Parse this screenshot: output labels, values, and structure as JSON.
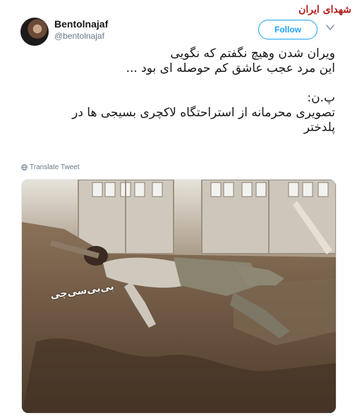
{
  "header": {
    "display_name": "Bentolnajaf",
    "handle": "@bentolnajaf",
    "follow_label": "Follow",
    "watermark": "شهدای ایران"
  },
  "tweet": {
    "lines": [
      "ویران شدن وهیچ نگفتم که نگویی",
      "این مرد عجب عاشق کم حوصله ای بود ...",
      "پ.ن:",
      "تصویری محرمانه از استراحتگاه لاکچری بسیجی ها در",
      "پلدختر"
    ],
    "translate_label": "Translate Tweet"
  },
  "photo": {
    "overlay_text": "بی‌بی‌سی‌چی"
  },
  "colors": {
    "accent": "#1da1f2",
    "muted": "#657786",
    "watermark": "#b31b1b"
  }
}
